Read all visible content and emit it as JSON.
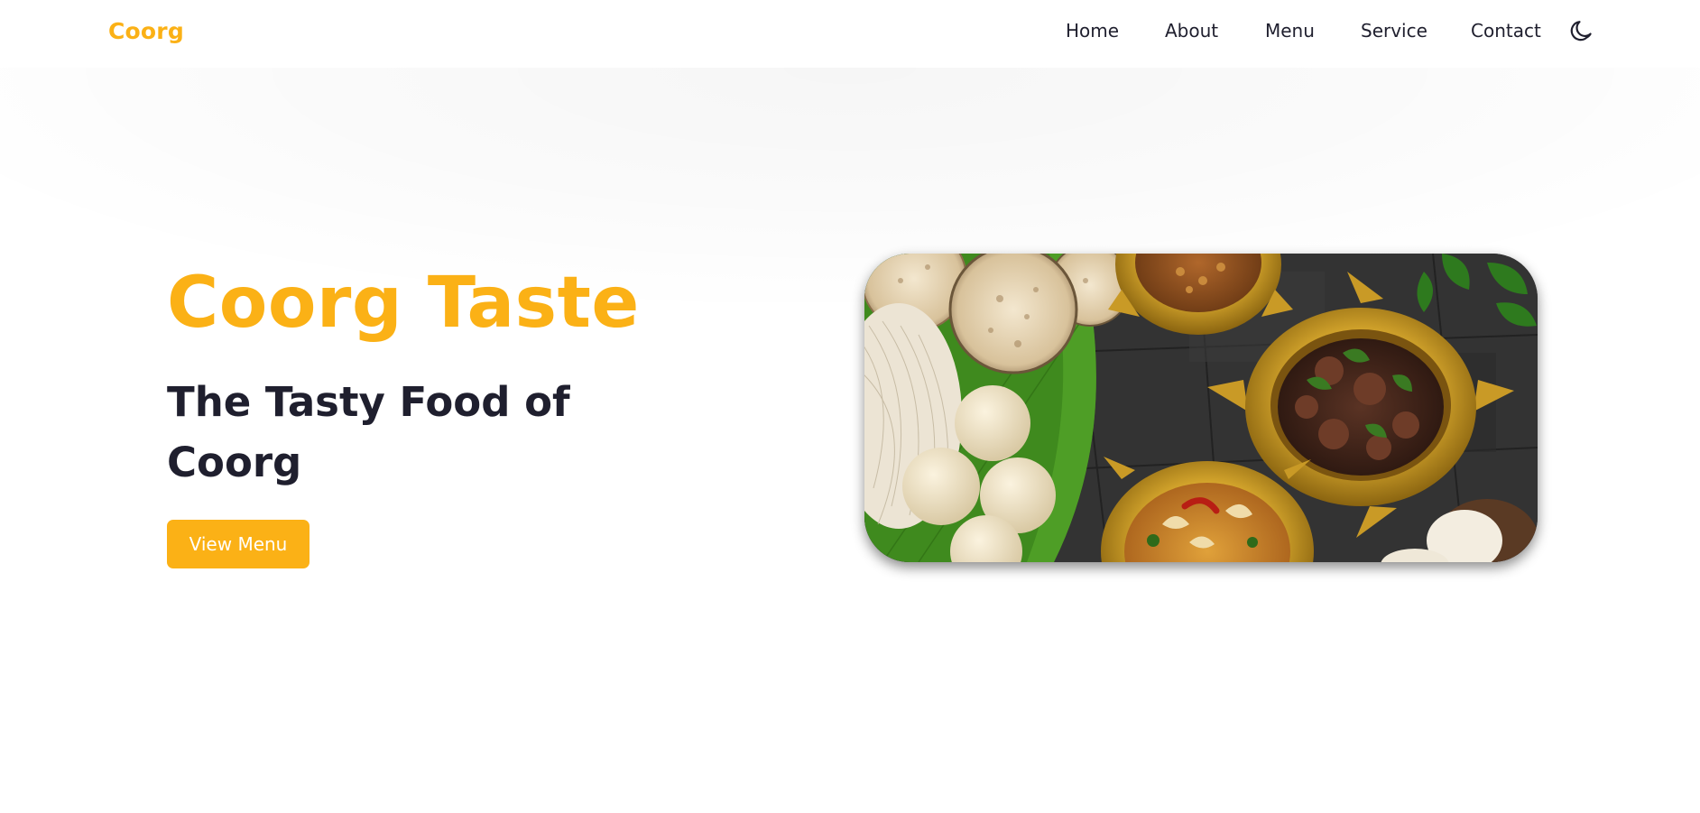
{
  "header": {
    "logo": "Coorg",
    "nav": {
      "home": "Home",
      "about": "About",
      "menu": "Menu",
      "service": "Service",
      "contact": "Contact"
    },
    "theme_toggle_icon": "moon-icon"
  },
  "hero": {
    "title": "Coorg Taste",
    "subtitle": "The Tasty Food of Coorg",
    "button_label": "View Menu",
    "image_alt": "Coorg food platter"
  },
  "colors": {
    "accent": "#fbb116",
    "text": "#1f1f2e",
    "background": "#ffffff"
  }
}
